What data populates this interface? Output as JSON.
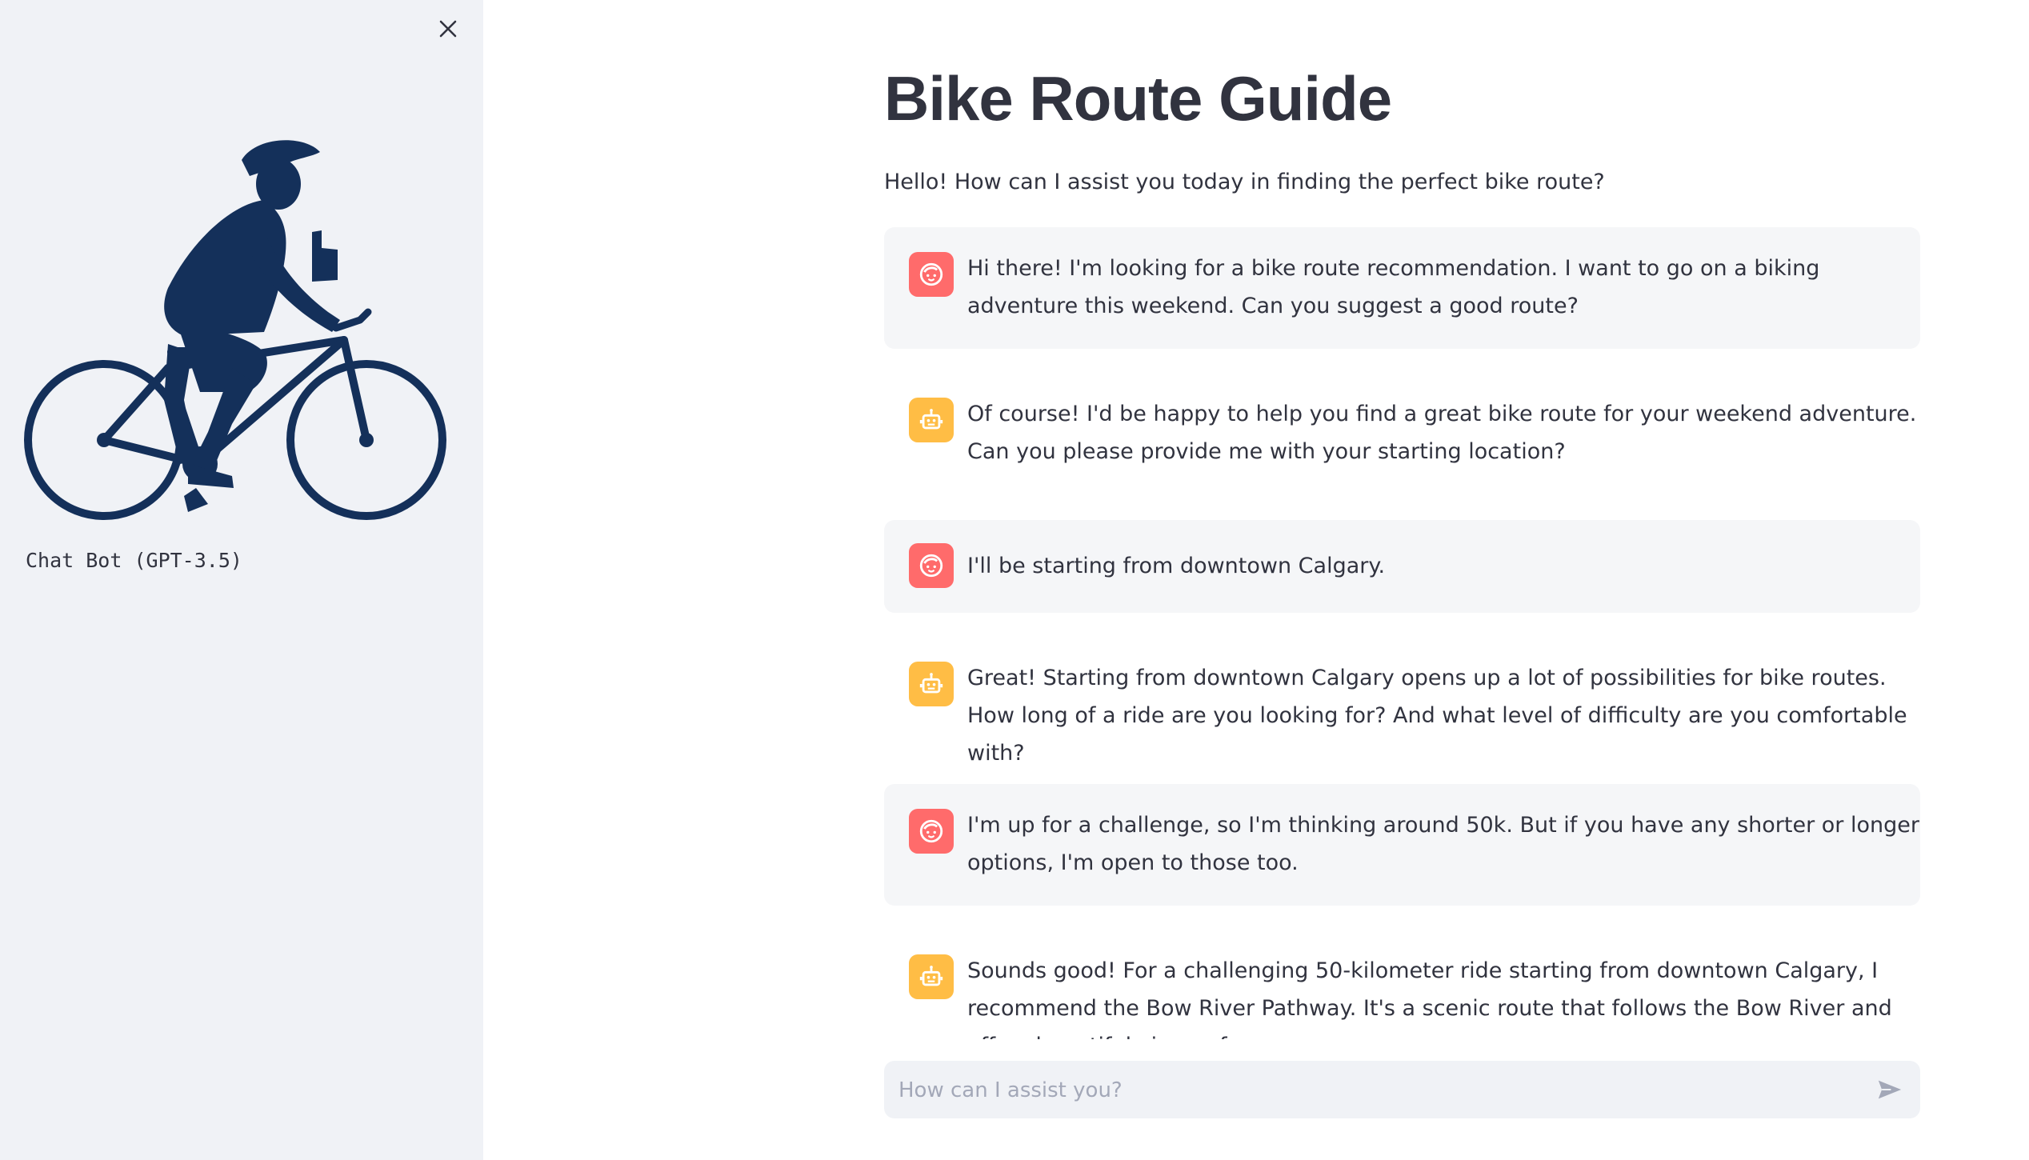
{
  "sidebar": {
    "close_icon": "close-icon",
    "logo": "cyclist-logo",
    "caption": "Chat Bot (GPT-3.5)"
  },
  "main": {
    "title": "Bike Route Guide",
    "greeting": "Hello! How can I assist you today in finding the perfect bike route?"
  },
  "messages": [
    {
      "role": "user",
      "icon": "user-face-icon",
      "text": "Hi there! I'm looking for a bike route recommendation. I want to go on a biking adventure this weekend. Can you suggest a good route?"
    },
    {
      "role": "assistant",
      "icon": "robot-icon",
      "text": "Of course! I'd be happy to help you find a great bike route for your weekend adventure. Can you please provide me with your starting location?"
    },
    {
      "role": "user",
      "icon": "user-face-icon",
      "text": "I'll be starting from downtown Calgary."
    },
    {
      "role": "assistant",
      "icon": "robot-icon",
      "text": "Great! Starting from downtown Calgary opens up a lot of possibilities for bike routes. How long of a ride are you looking for? And what level of difficulty are you comfortable with?"
    },
    {
      "role": "user",
      "icon": "user-face-icon",
      "text": "I'm up for a challenge, so I'm thinking around 50k. But if you have any shorter or longer options, I'm open to those too."
    },
    {
      "role": "assistant",
      "icon": "robot-icon",
      "text": "Sounds good! For a challenging 50-kilometer ride starting from downtown Calgary, I recommend the Bow River Pathway. It's a scenic route that follows the Bow River and offers beautiful views of"
    }
  ],
  "chat_input": {
    "placeholder": "How can I assist you?",
    "value": "",
    "send_icon": "send-icon"
  },
  "colors": {
    "sidebar_bg": "#f0f2f6",
    "user_avatar": "#ff6b6b",
    "assistant_avatar": "#ffbd45",
    "user_message_bg": "#f5f6f8",
    "logo_navy": "#14305a"
  }
}
